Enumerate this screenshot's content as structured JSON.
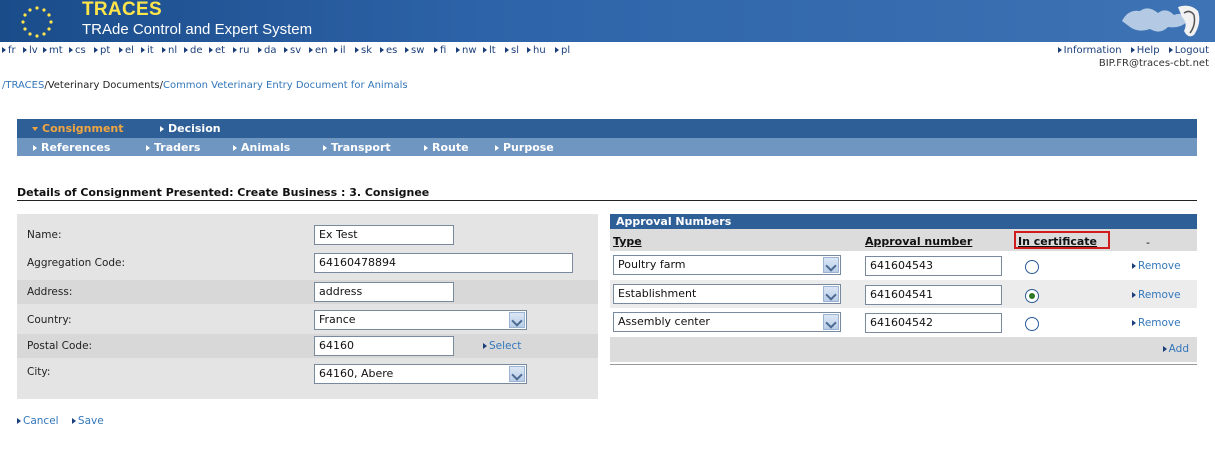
{
  "header": {
    "brand_name": "TRACES",
    "brand_tagline": "TRAde Control and Expert System"
  },
  "languages": [
    "fr",
    "lv",
    "mt",
    "cs",
    "pt",
    "el",
    "it",
    "nl",
    "de",
    "et",
    "ru",
    "da",
    "sv",
    "en",
    "il",
    "sk",
    "es",
    "sw",
    "fi",
    "nw",
    "lt",
    "sl",
    "hu",
    "pl"
  ],
  "top_links": [
    "Information",
    "Help",
    "Logout"
  ],
  "user_email": "BIP.FR@traces-cbt.net",
  "breadcrumb": {
    "root": "/TRACES",
    "sep1": "/",
    "level1": "Veterinary Documents",
    "sep2": "/",
    "level2": "Common Veterinary Entry Document for Animals"
  },
  "tabs": {
    "main": [
      {
        "label": "Consignment",
        "active": true
      },
      {
        "label": "Decision",
        "active": false
      }
    ],
    "sub": [
      "References",
      "Traders",
      "Animals",
      "Transport",
      "Route",
      "Purpose"
    ]
  },
  "section_title": "Details of Consignment Presented: Create Business : 3. Consignee",
  "form": {
    "name_label": "Name:",
    "name_value": "Ex Test",
    "aggregation_label": "Aggregation Code:",
    "aggregation_value": "64160478894",
    "address_label": "Address:",
    "address_value": "address",
    "country_label": "Country:",
    "country_value": "France",
    "postal_label": "Postal Code:",
    "postal_value": "64160",
    "select_label": "Select",
    "city_label": "City:",
    "city_value": "64160, Abere"
  },
  "approvals": {
    "title": "Approval Numbers",
    "col_type": "Type",
    "col_number": "Approval number",
    "col_cert": "In certificate",
    "col_extra": "-",
    "rows": [
      {
        "type": "Poultry farm",
        "number": "641604543",
        "in_certificate": false,
        "remove": "Remove"
      },
      {
        "type": "Establishment",
        "number": "641604541",
        "in_certificate": true,
        "remove": "Remove"
      },
      {
        "type": "Assembly center",
        "number": "641604542",
        "in_certificate": false,
        "remove": "Remove"
      }
    ],
    "add_label": "Add"
  },
  "actions": {
    "cancel": "Cancel",
    "save": "Save"
  },
  "colors": {
    "tab_bar": "#2f5f97",
    "subtab_bar": "#6f96c1",
    "active_tab": "#f0a640",
    "link": "#3377bb",
    "highlight_box": "#d01c1c"
  }
}
